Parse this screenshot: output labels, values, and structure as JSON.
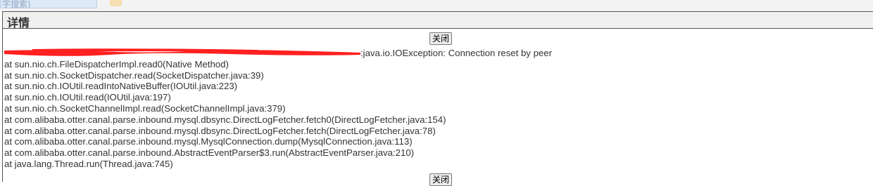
{
  "top_bar": {
    "search_text": "字搜索)"
  },
  "dialog": {
    "title": "详情",
    "close_label": "关闭",
    "exception_suffix": ":java.io.IOException: Connection reset by peer",
    "redaction_color": "#ff2020",
    "stack_trace": [
      "at sun.nio.ch.FileDispatcherImpl.read0(Native Method)",
      "at sun.nio.ch.SocketDispatcher.read(SocketDispatcher.java:39)",
      "at sun.nio.ch.IOUtil.readIntoNativeBuffer(IOUtil.java:223)",
      "at sun.nio.ch.IOUtil.read(IOUtil.java:197)",
      "at sun.nio.ch.SocketChannelImpl.read(SocketChannelImpl.java:379)",
      "at com.alibaba.otter.canal.parse.inbound.mysql.dbsync.DirectLogFetcher.fetch0(DirectLogFetcher.java:154)",
      "at com.alibaba.otter.canal.parse.inbound.mysql.dbsync.DirectLogFetcher.fetch(DirectLogFetcher.java:78)",
      "at com.alibaba.otter.canal.parse.inbound.mysql.MysqlConnection.dump(MysqlConnection.java:113)",
      "at com.alibaba.otter.canal.parse.inbound.AbstractEventParser$3.run(AbstractEventParser.java:210)",
      "at java.lang.Thread.run(Thread.java:745)"
    ]
  }
}
